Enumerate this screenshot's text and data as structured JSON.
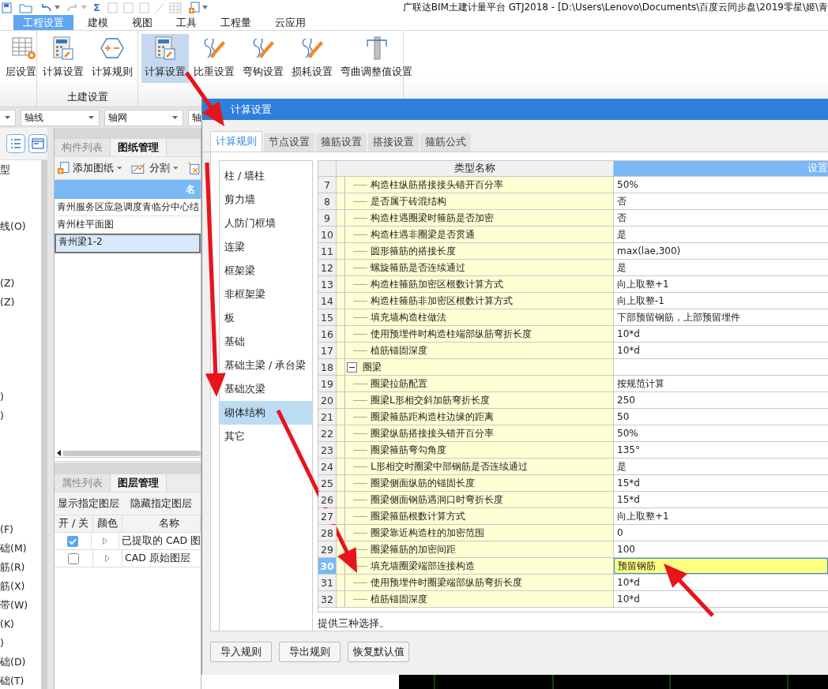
{
  "app_title": "广联达BIM土建计量平台 GTJ2018 - [D:\\Users\\Lenovo\\Documents\\百度云同步盘\\2019零星\\姬\\青",
  "sum_symbol": "Σ",
  "menu_tabs": [
    {
      "label": "工程设置",
      "selected": true
    },
    {
      "label": "建模",
      "selected": false
    },
    {
      "label": "视图",
      "selected": false
    },
    {
      "label": "工具",
      "selected": false
    },
    {
      "label": "工程量",
      "selected": false
    },
    {
      "label": "云应用",
      "selected": false
    }
  ],
  "ribbon_groups": [
    {
      "buttons": [
        {
          "label": "层设置",
          "kind": "floor",
          "selected": false
        }
      ]
    },
    {
      "label": "土建设置",
      "buttons": [
        {
          "label": "计算设置",
          "kind": "calc",
          "selected": false
        },
        {
          "label": "计算规则",
          "kind": "rule",
          "selected": false
        }
      ]
    },
    {
      "buttons": [
        {
          "label": "计算设置",
          "kind": "calc",
          "selected": true
        },
        {
          "label": "比重设置",
          "kind": "hook",
          "selected": false
        },
        {
          "label": "弯钩设置",
          "kind": "hook",
          "selected": false
        },
        {
          "label": "损耗设置",
          "kind": "hook",
          "selected": false
        },
        {
          "label": "弯曲调整值设置",
          "kind": "column",
          "selected": false
        }
      ]
    }
  ],
  "filters": [
    "轴线",
    "轴网",
    "轴"
  ],
  "tree_items": [
    "型",
    "线(O)",
    "(Z)",
    "(Z)",
    ")",
    ")",
    "(F)",
    "础(M)",
    "筋(R)",
    "筋(X)",
    "带(W)",
    "(K)",
    ")",
    "础(D)",
    "础(T)"
  ],
  "drawing_panel": {
    "tabs": [
      {
        "label": "构件列表",
        "selected": false
      },
      {
        "label": "图纸管理",
        "selected": true
      }
    ],
    "tools": [
      "添加图纸",
      "分割"
    ],
    "column": "名",
    "rows": [
      {
        "name": "青州服务区应急调度青临分中心结",
        "selected": false
      },
      {
        "name": "青州柱平面图",
        "selected": false
      },
      {
        "name": "青州梁1-2",
        "selected": true
      }
    ]
  },
  "layer_panel": {
    "tabs": [
      {
        "label": "属性列表",
        "selected": false
      },
      {
        "label": "图层管理",
        "selected": true
      }
    ],
    "actions": [
      "显示指定图层",
      "隐藏指定图层"
    ],
    "columns": [
      "开 / 关",
      "颜色",
      "名称"
    ],
    "rows": [
      {
        "on": true,
        "name": "已提取的 CAD 图"
      },
      {
        "on": false,
        "name": "CAD 原始图层"
      }
    ]
  },
  "dialog": {
    "title": "计算设置",
    "tabs": [
      {
        "label": "计算规则",
        "selected": true
      },
      {
        "label": "节点设置",
        "selected": false
      },
      {
        "label": "箍筋设置",
        "selected": false
      },
      {
        "label": "搭接设置",
        "selected": false
      },
      {
        "label": "箍筋公式",
        "selected": false
      }
    ],
    "categories": [
      {
        "label": "柱 / 墙柱",
        "selected": false
      },
      {
        "label": "剪力墙",
        "selected": false
      },
      {
        "label": "人防门框墙",
        "selected": false
      },
      {
        "label": "连梁",
        "selected": false
      },
      {
        "label": "框架梁",
        "selected": false
      },
      {
        "label": "非框架梁",
        "selected": false
      },
      {
        "label": "板",
        "selected": false
      },
      {
        "label": "基础",
        "selected": false
      },
      {
        "label": "基础主梁 / 承台梁",
        "selected": false
      },
      {
        "label": "基础次梁",
        "selected": false
      },
      {
        "label": "砌体结构",
        "selected": true
      },
      {
        "label": "其它",
        "selected": false
      }
    ],
    "columns": [
      "类型名称",
      "设置"
    ],
    "rows": [
      {
        "no": "7",
        "kind": "item",
        "name": "构造柱纵筋搭接接头错开百分率",
        "value": "50%",
        "selected": false
      },
      {
        "no": "8",
        "kind": "item",
        "name": "是否属于砖混结构",
        "value": "否",
        "selected": false
      },
      {
        "no": "9",
        "kind": "item",
        "name": "构造柱遇圈梁时箍筋是否加密",
        "value": "否",
        "selected": false
      },
      {
        "no": "10",
        "kind": "item",
        "name": "构造柱遇非圈梁是否贯通",
        "value": "是",
        "selected": false
      },
      {
        "no": "11",
        "kind": "item",
        "name": "圆形箍筋的搭接长度",
        "value": "max(lae,300)",
        "selected": false
      },
      {
        "no": "12",
        "kind": "item",
        "name": "螺旋箍筋是否连续通过",
        "value": "是",
        "selected": false
      },
      {
        "no": "13",
        "kind": "item",
        "name": "构造柱箍筋加密区根数计算方式",
        "value": "向上取整+1",
        "selected": false
      },
      {
        "no": "14",
        "kind": "item",
        "name": "构造柱箍筋非加密区根数计算方式",
        "value": "向上取整-1",
        "selected": false
      },
      {
        "no": "15",
        "kind": "item",
        "name": "填充墙构造柱做法",
        "value": "下部预留钢筋，上部预留埋件",
        "selected": false
      },
      {
        "no": "16",
        "kind": "item",
        "name": "使用预埋件时构造柱端部纵筋弯折长度",
        "value": "10*d",
        "selected": false
      },
      {
        "no": "17",
        "kind": "item",
        "name": "植筋锚固深度",
        "value": "10*d",
        "selected": false
      },
      {
        "no": "18",
        "kind": "group",
        "name": "圈梁",
        "expanded": true,
        "selected": false
      },
      {
        "no": "19",
        "kind": "item",
        "name": "圈梁拉筋配置",
        "value": "按规范计算",
        "selected": false
      },
      {
        "no": "20",
        "kind": "item",
        "name": "圈梁L形相交斜加筋弯折长度",
        "value": "250",
        "selected": false
      },
      {
        "no": "21",
        "kind": "item",
        "name": "圈梁箍筋距构造柱边缘的距离",
        "value": "50",
        "selected": false
      },
      {
        "no": "22",
        "kind": "item",
        "name": "圈梁纵筋搭接接头错开百分率",
        "value": "50%",
        "selected": false
      },
      {
        "no": "23",
        "kind": "item",
        "name": "圈梁箍筋弯勾角度",
        "value": "135°",
        "selected": false
      },
      {
        "no": "24",
        "kind": "item",
        "name": "L形相交时圈梁中部钢筋是否连续通过",
        "value": "是",
        "selected": false
      },
      {
        "no": "25",
        "kind": "item",
        "name": "圈梁侧面纵筋的锚固长度",
        "value": "15*d",
        "selected": false
      },
      {
        "no": "26",
        "kind": "item",
        "name": "圈梁侧面钢筋遇洞口时弯折长度",
        "value": "15*d",
        "selected": false
      },
      {
        "no": "27",
        "kind": "item",
        "name": "圈梁箍筋根数计算方式",
        "value": "向上取整+1",
        "selected": false
      },
      {
        "no": "28",
        "kind": "item",
        "name": "圈梁靠近构造柱的加密范围",
        "value": "0",
        "selected": false
      },
      {
        "no": "29",
        "kind": "item",
        "name": "圈梁箍筋的加密间距",
        "value": "100",
        "selected": false
      },
      {
        "no": "30",
        "kind": "item",
        "name": "填充墙圈梁端部连接构造",
        "value": "预留钢筋",
        "selected": true
      },
      {
        "no": "31",
        "kind": "item",
        "name": "使用预埋件时圈梁端部纵筋弯折长度",
        "value": "10*d",
        "selected": false
      },
      {
        "no": "32",
        "kind": "item",
        "name": "植筋锚固深度",
        "value": "10*d",
        "selected": false
      }
    ],
    "description": "提供三种选择。",
    "buttons": [
      "导入规则",
      "导出规则",
      "恢复默认值"
    ]
  }
}
